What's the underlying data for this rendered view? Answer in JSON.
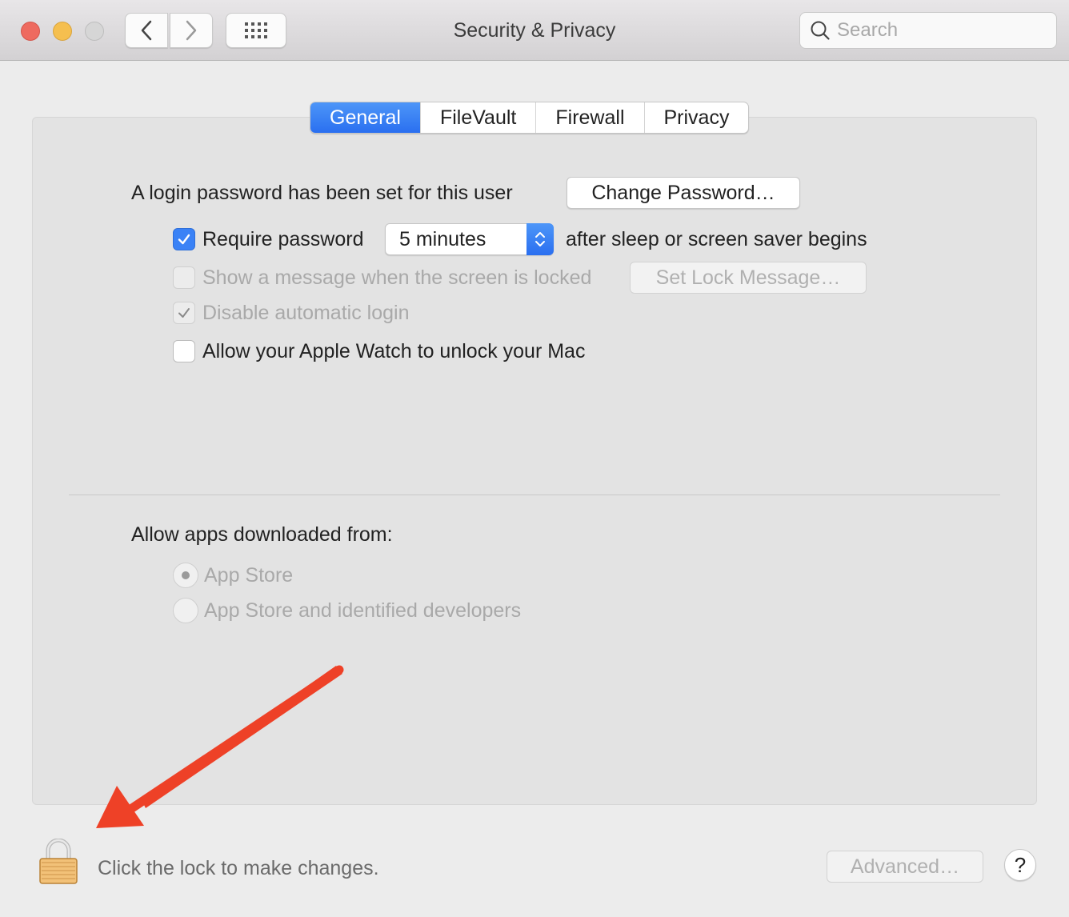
{
  "window": {
    "title": "Security & Privacy",
    "search_placeholder": "Search",
    "search_value": ""
  },
  "tabs": [
    {
      "label": "General",
      "active": true
    },
    {
      "label": "FileVault",
      "active": false
    },
    {
      "label": "Firewall",
      "active": false
    },
    {
      "label": "Privacy",
      "active": false
    }
  ],
  "general": {
    "login_password_text": "A login password has been set for this user",
    "change_password_button": "Change Password…",
    "require_password": {
      "label": "Require password",
      "checked": true,
      "select_value": "5 minutes",
      "suffix": "after sleep or screen saver begins"
    },
    "show_message": {
      "label": "Show a message when the screen is locked",
      "checked": false,
      "disabled": true,
      "button": "Set Lock Message…"
    },
    "disable_auto_login": {
      "label": "Disable automatic login",
      "checked": true,
      "disabled": true
    },
    "apple_watch": {
      "label": "Allow your Apple Watch to unlock your Mac",
      "checked": false
    },
    "allow_apps": {
      "heading": "Allow apps downloaded from:",
      "options": [
        {
          "label": "App Store",
          "selected": true,
          "disabled": true
        },
        {
          "label": "App Store and identified developers",
          "selected": false,
          "disabled": true
        }
      ]
    }
  },
  "footer": {
    "lock_text": "Click the lock to make changes.",
    "advanced_button": "Advanced…",
    "help_button": "?"
  },
  "colors": {
    "accent": "#3a82f6",
    "annotation_arrow": "#ee4127"
  }
}
